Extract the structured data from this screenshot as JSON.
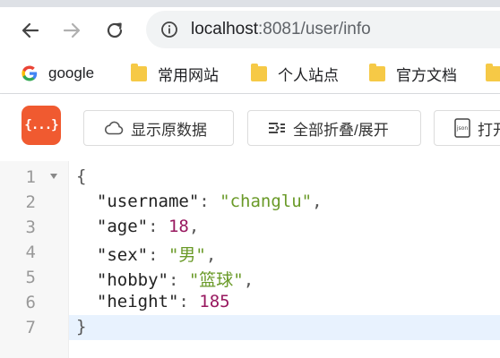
{
  "browser": {
    "url_host": "localhost",
    "url_path": ":8081/user/info",
    "nav_icons": [
      "back-arrow-icon",
      "forward-arrow-icon",
      "reload-icon",
      "site-info-icon"
    ]
  },
  "bookmarks": [
    {
      "label": "google",
      "icon": "google-icon"
    },
    {
      "label": "常用网站",
      "icon": "folder-icon"
    },
    {
      "label": "个人站点",
      "icon": "folder-icon"
    },
    {
      "label": "官方文档",
      "icon": "folder-icon"
    }
  ],
  "toolbar": {
    "logo": "{...}",
    "raw_label": "显示原数据",
    "fold_label": "全部折叠/展开",
    "print_label": "打开",
    "accent": "#f05a30"
  },
  "json_view": {
    "line_numbers": [
      "1",
      "2",
      "3",
      "4",
      "5",
      "6",
      "7"
    ],
    "open_brace": "{",
    "close_brace": "}",
    "entries": [
      {
        "key": "\"username\"",
        "value": "\"changlu\"",
        "type": "string"
      },
      {
        "key": "\"age\"",
        "value": "18",
        "type": "number"
      },
      {
        "key": "\"sex\"",
        "value": "\"男\"",
        "type": "string"
      },
      {
        "key": "\"hobby\"",
        "value": "\"篮球\"",
        "type": "string"
      },
      {
        "key": "\"height\"",
        "value": "185",
        "type": "number"
      }
    ],
    "colors": {
      "string": "#6a9a28",
      "number": "#98185f",
      "highlight": "#e8f2fe"
    }
  }
}
